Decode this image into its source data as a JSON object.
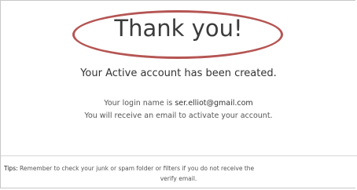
{
  "title": "Thank you!",
  "subtitle": "Your Active account has been created.",
  "login": {
    "prefix": "Your login name is ",
    "email": "ser.elliot@gmail.com"
  },
  "activation_note": "You will receive an email to activate your account.",
  "tips": {
    "label": "Tips:",
    "text_line1": " Remember to check your junk or spam folder or filters if you do not receive the",
    "text_line2": "verify email."
  },
  "colors": {
    "annotation_ellipse": "#b55553",
    "text": "#333333"
  }
}
